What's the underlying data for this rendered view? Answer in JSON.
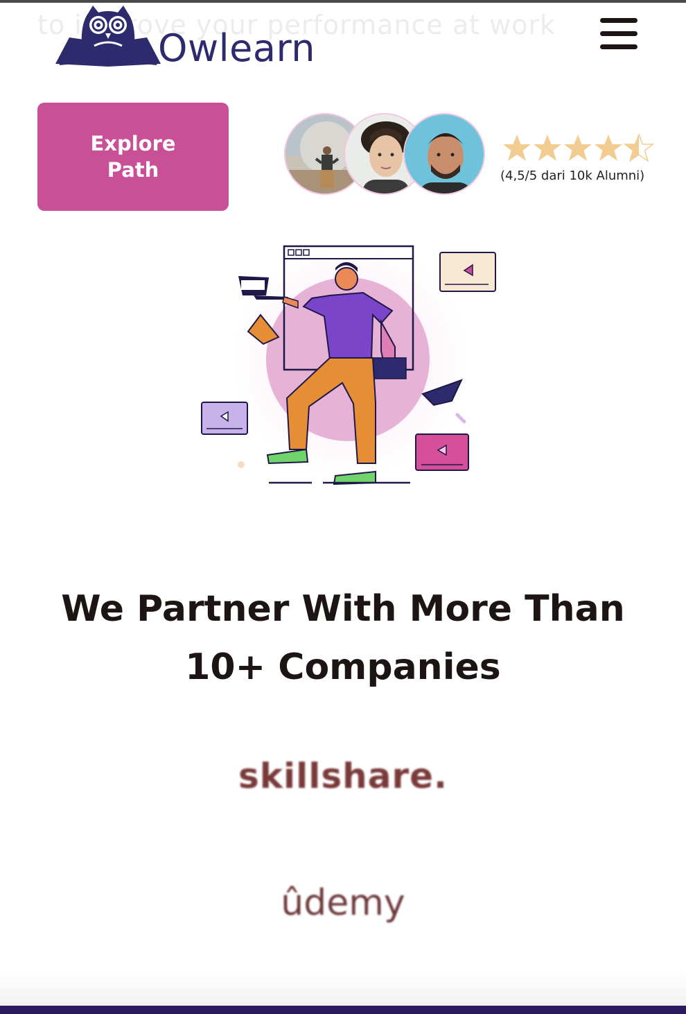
{
  "header": {
    "brand_name": "Owlearn",
    "background_tagline": "to improve your performance at work",
    "menu_icon": "hamburger-menu-icon"
  },
  "hero": {
    "cta_label": "Explore Path",
    "avatars": [
      "alumni-avatar-1",
      "alumni-avatar-2",
      "alumni-avatar-3"
    ],
    "rating_value": 4.5,
    "rating_max": 5,
    "rating_text": "(4,5/5 dari 10k Alumni)",
    "illustration": "person-with-laptop-illustration"
  },
  "partners": {
    "title": "We Partner With More Than 10+ Companies",
    "logos": [
      "skillshare.",
      "ûdemy"
    ]
  },
  "colors": {
    "brand_navy": "#2e2a6e",
    "cta_pink": "#c94f96",
    "star_gold": "#f2cd92",
    "text_dark": "#1d1414",
    "partner_logo": "#7a3a3a"
  }
}
